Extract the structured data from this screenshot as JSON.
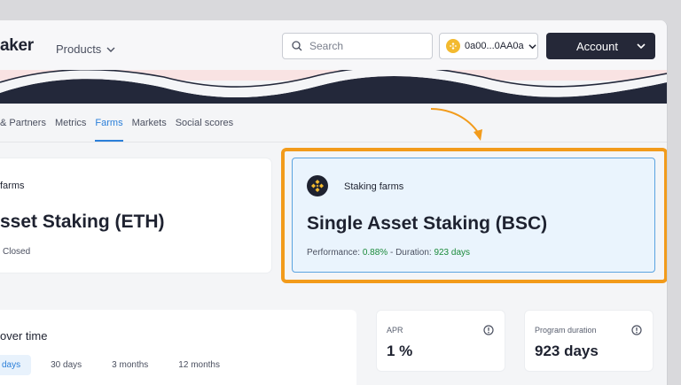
{
  "header": {
    "logo_text": "aker",
    "products_label": "Products",
    "search_placeholder": "Search",
    "wallet_address": "0a00...0AA0a",
    "account_label": "Account"
  },
  "nav": {
    "items": [
      "& Partners",
      "Metrics",
      "Farms",
      "Markets",
      "Social scores"
    ],
    "active": "Farms"
  },
  "farm_left": {
    "subtitle": "farms",
    "title": "sset Staking (ETH)",
    "status": "Closed"
  },
  "farm_right": {
    "icon": "bnb-icon",
    "subtitle": "Staking farms",
    "title": "Single Asset Staking (BSC)",
    "performance_label": "Performance:",
    "performance_value": "0.88%",
    "separator": "-",
    "duration_label": "Duration:",
    "duration_value": "923 days"
  },
  "chart_panel": {
    "title": "over time",
    "ranges": [
      "days",
      "30 days",
      "3 months",
      "12 months"
    ],
    "selected_range": "days"
  },
  "stats": {
    "apr_label": "APR",
    "apr_value": "1 %",
    "duration_label": "Program duration",
    "duration_value": "923 days"
  },
  "colors": {
    "accent": "#2b7fd9",
    "highlight": "#f29b1b",
    "positive": "#1b8a3a",
    "dark": "#252838"
  }
}
